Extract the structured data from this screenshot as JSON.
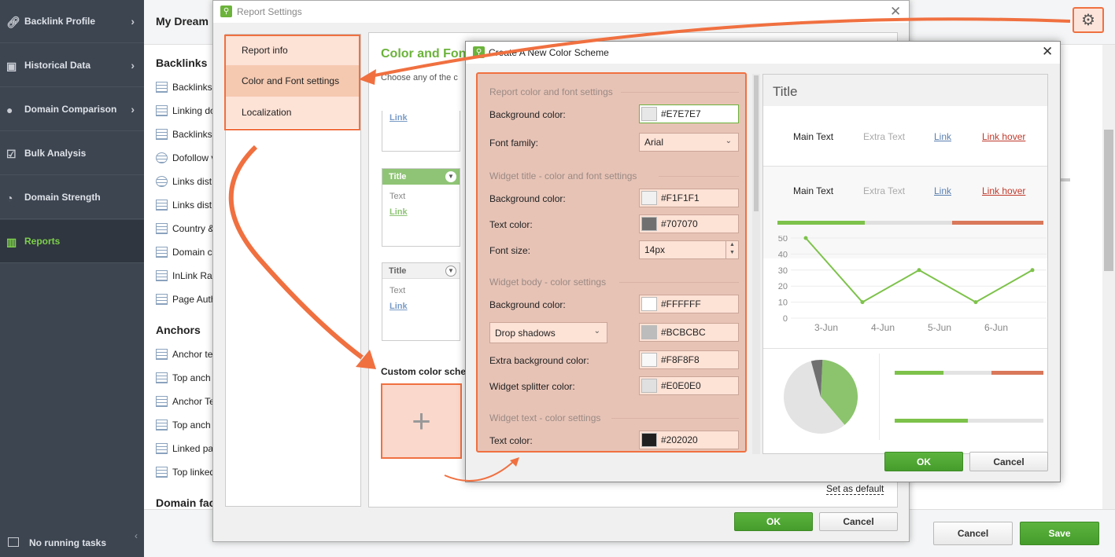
{
  "sidebar": {
    "items": [
      {
        "label": "Backlink Profile"
      },
      {
        "label": "Historical Data"
      },
      {
        "label": "Domain Comparison"
      },
      {
        "label": "Bulk Analysis"
      },
      {
        "label": "Domain Strength"
      },
      {
        "label": "Reports"
      }
    ],
    "footer": "No running tasks"
  },
  "main": {
    "title": "My Dream",
    "sections": [
      {
        "title": "Backlinks",
        "items": [
          "Backlinks",
          "Linking do",
          "Backlinks",
          "Dofollow v",
          "Links dist",
          "Links dist",
          "Country &",
          "Domain c",
          "InLink Ra",
          "Page Auth"
        ]
      },
      {
        "title": "Anchors",
        "items": [
          "Anchor tex",
          "Top anch",
          "Anchor Te",
          "Top anch",
          "Linked pa",
          "Top linked"
        ]
      },
      {
        "title": "Domain fac"
      }
    ],
    "footer": {
      "cancel": "Cancel",
      "save": "Save"
    }
  },
  "report_settings": {
    "title": "Report Settings",
    "menu": [
      "Report info",
      "Color and Font settings",
      "Localization"
    ],
    "heading": "Color and Fon",
    "subtitle": "Choose any of the c",
    "swatches": [
      {
        "link": "Link"
      },
      {
        "title": "Title",
        "text": "Text",
        "link": "Link"
      },
      {
        "title": "Title",
        "text": "Text",
        "link": "Link"
      }
    ],
    "custom_label": "Custom color sche",
    "add_symbol": "+",
    "set_default": "Set as default",
    "ok": "OK",
    "cancel": "Cancel"
  },
  "color_scheme": {
    "title": "Create A New Color Scheme",
    "sections": {
      "report": "Report color and font settings",
      "widget_title": "Widget title - color and font settings",
      "widget_body": "Widget body - color settings",
      "widget_text": "Widget text - color settings"
    },
    "fields": {
      "report_bg_label": "Background color:",
      "report_bg": "#E7E7E7",
      "font_family_label": "Font family:",
      "font_family": "Arial",
      "title_bg_label": "Background color:",
      "title_bg": "#F1F1F1",
      "title_text_label": "Text color:",
      "title_text": "#707070",
      "font_size_label": "Font size:",
      "font_size": "14px",
      "body_bg_label": "Background color:",
      "body_bg": "#FFFFFF",
      "shadow_select": "Drop shadows",
      "shadow_color": "#BCBCBC",
      "extra_bg_label": "Extra background color:",
      "extra_bg": "#F8F8F8",
      "splitter_label": "Widget splitter color:",
      "splitter": "#E0E0E0",
      "text_color_label": "Text color:",
      "text_color": "#202020"
    },
    "preview": {
      "title": "Title",
      "main_text": "Main Text",
      "extra_text": "Extra Text",
      "link": "Link",
      "link_hover": "Link hover"
    },
    "ok": "OK",
    "cancel": "Cancel"
  },
  "chart_data": {
    "type": "line",
    "x": [
      "3-Jun",
      "4-Jun",
      "5-Jun",
      "6-Jun"
    ],
    "y_ticks": [
      0,
      10,
      20,
      30,
      40,
      50
    ],
    "series": [
      {
        "values": [
          50,
          10,
          30,
          10,
          30
        ]
      }
    ],
    "ylim": [
      0,
      50
    ],
    "color": "#7dc24a"
  },
  "pie_data": {
    "type": "pie",
    "slices": [
      {
        "value": 38,
        "color": "#8bc46c"
      },
      {
        "value": 57,
        "color": "#e3e3e3"
      },
      {
        "value": 5,
        "color": "#707070"
      }
    ]
  },
  "colors": {
    "accent": "#6bb33a",
    "highlight": "#f07040",
    "sidebar": "#3d4551"
  }
}
